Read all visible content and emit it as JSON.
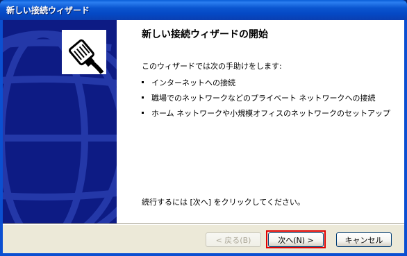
{
  "window": {
    "title": "新しい接続ウィザード"
  },
  "main": {
    "heading": "新しい接続ウィザードの開始",
    "intro": "このウィザードでは次の手助けをします:",
    "bullets": [
      "インターネットへの接続",
      "職場でのネットワークなどのプライベート ネットワークへの接続",
      "ホーム ネットワークや小規模オフィスのネットワークのセットアップ"
    ],
    "footer": "続行するには [次へ] をクリックしてください。"
  },
  "buttons": {
    "back": "< 戻る(B)",
    "next": "次へ(N) >",
    "cancel": "キャンセル"
  },
  "icons": {
    "wizard": "network-cable-plug-icon",
    "background": "globe-wireframe"
  },
  "colors": {
    "title_bar": "#0a55d0",
    "left_panel": "#0d1b84",
    "highlight": "#e00000"
  }
}
